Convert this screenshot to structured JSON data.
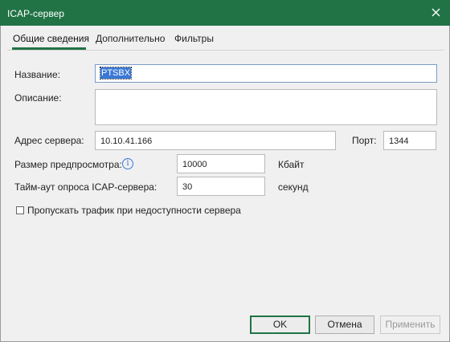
{
  "window": {
    "title": "ICAP-сервер",
    "close_icon": "close-icon"
  },
  "tabs": [
    {
      "label": "Общие сведения",
      "active": true
    },
    {
      "label": "Дополнительно",
      "active": false
    },
    {
      "label": "Фильтры",
      "active": false
    }
  ],
  "form": {
    "name_label": "Название:",
    "name_value": "PTSBX",
    "description_label": "Описание:",
    "description_value": "",
    "server_address_label": "Адрес сервера:",
    "server_address_value": "10.10.41.166",
    "port_label": "Порт:",
    "port_value": "1344",
    "preview_size_label": "Размер предпросмотра:",
    "preview_size_info_icon": "info-icon",
    "preview_size_value": "10000",
    "preview_size_unit": "Кбайт",
    "timeout_label": "Тайм-аут опроса ICAP-сервера:",
    "timeout_value": "30",
    "timeout_unit": "секунд",
    "skip_traffic_label": "Пропускать трафик при недоступности сервера",
    "skip_traffic_checked": false
  },
  "buttons": {
    "ok": "OK",
    "cancel": "Отмена",
    "apply": "Применить"
  },
  "colors": {
    "accent": "#217346",
    "selection": "#3a78d6"
  }
}
